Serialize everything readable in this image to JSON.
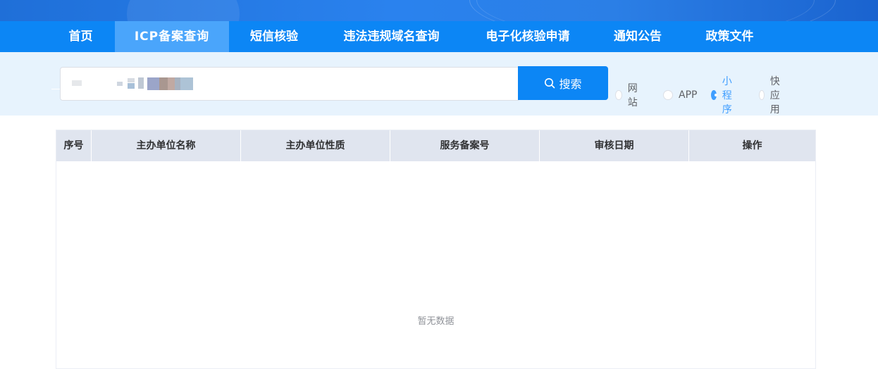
{
  "nav": {
    "items": [
      {
        "label": "首页"
      },
      {
        "label": "ICP备案查询"
      },
      {
        "label": "短信核验"
      },
      {
        "label": "违法违规域名查询"
      },
      {
        "label": "电子化核验申请"
      },
      {
        "label": "通知公告"
      },
      {
        "label": "政策文件"
      }
    ],
    "active_index": 1
  },
  "search": {
    "value_obscured": true,
    "button_label": "搜索",
    "button_icon": "search-icon"
  },
  "radio_options": [
    {
      "label": "网站",
      "checked": false
    },
    {
      "label": "APP",
      "checked": false
    },
    {
      "label": "小程序",
      "checked": true
    },
    {
      "label": "快应用",
      "checked": false
    }
  ],
  "table": {
    "columns": [
      "序号",
      "主办单位名称",
      "主办单位性质",
      "服务备案号",
      "审核日期",
      "操作"
    ],
    "rows": [],
    "empty_text": "暂无数据"
  },
  "colors": {
    "nav_bg": "#0c86f5",
    "nav_active_bg": "#4aa5fb",
    "search_band_bg": "#e7f3fd",
    "accent": "#409eff",
    "table_header_bg": "#e0e5ef"
  }
}
